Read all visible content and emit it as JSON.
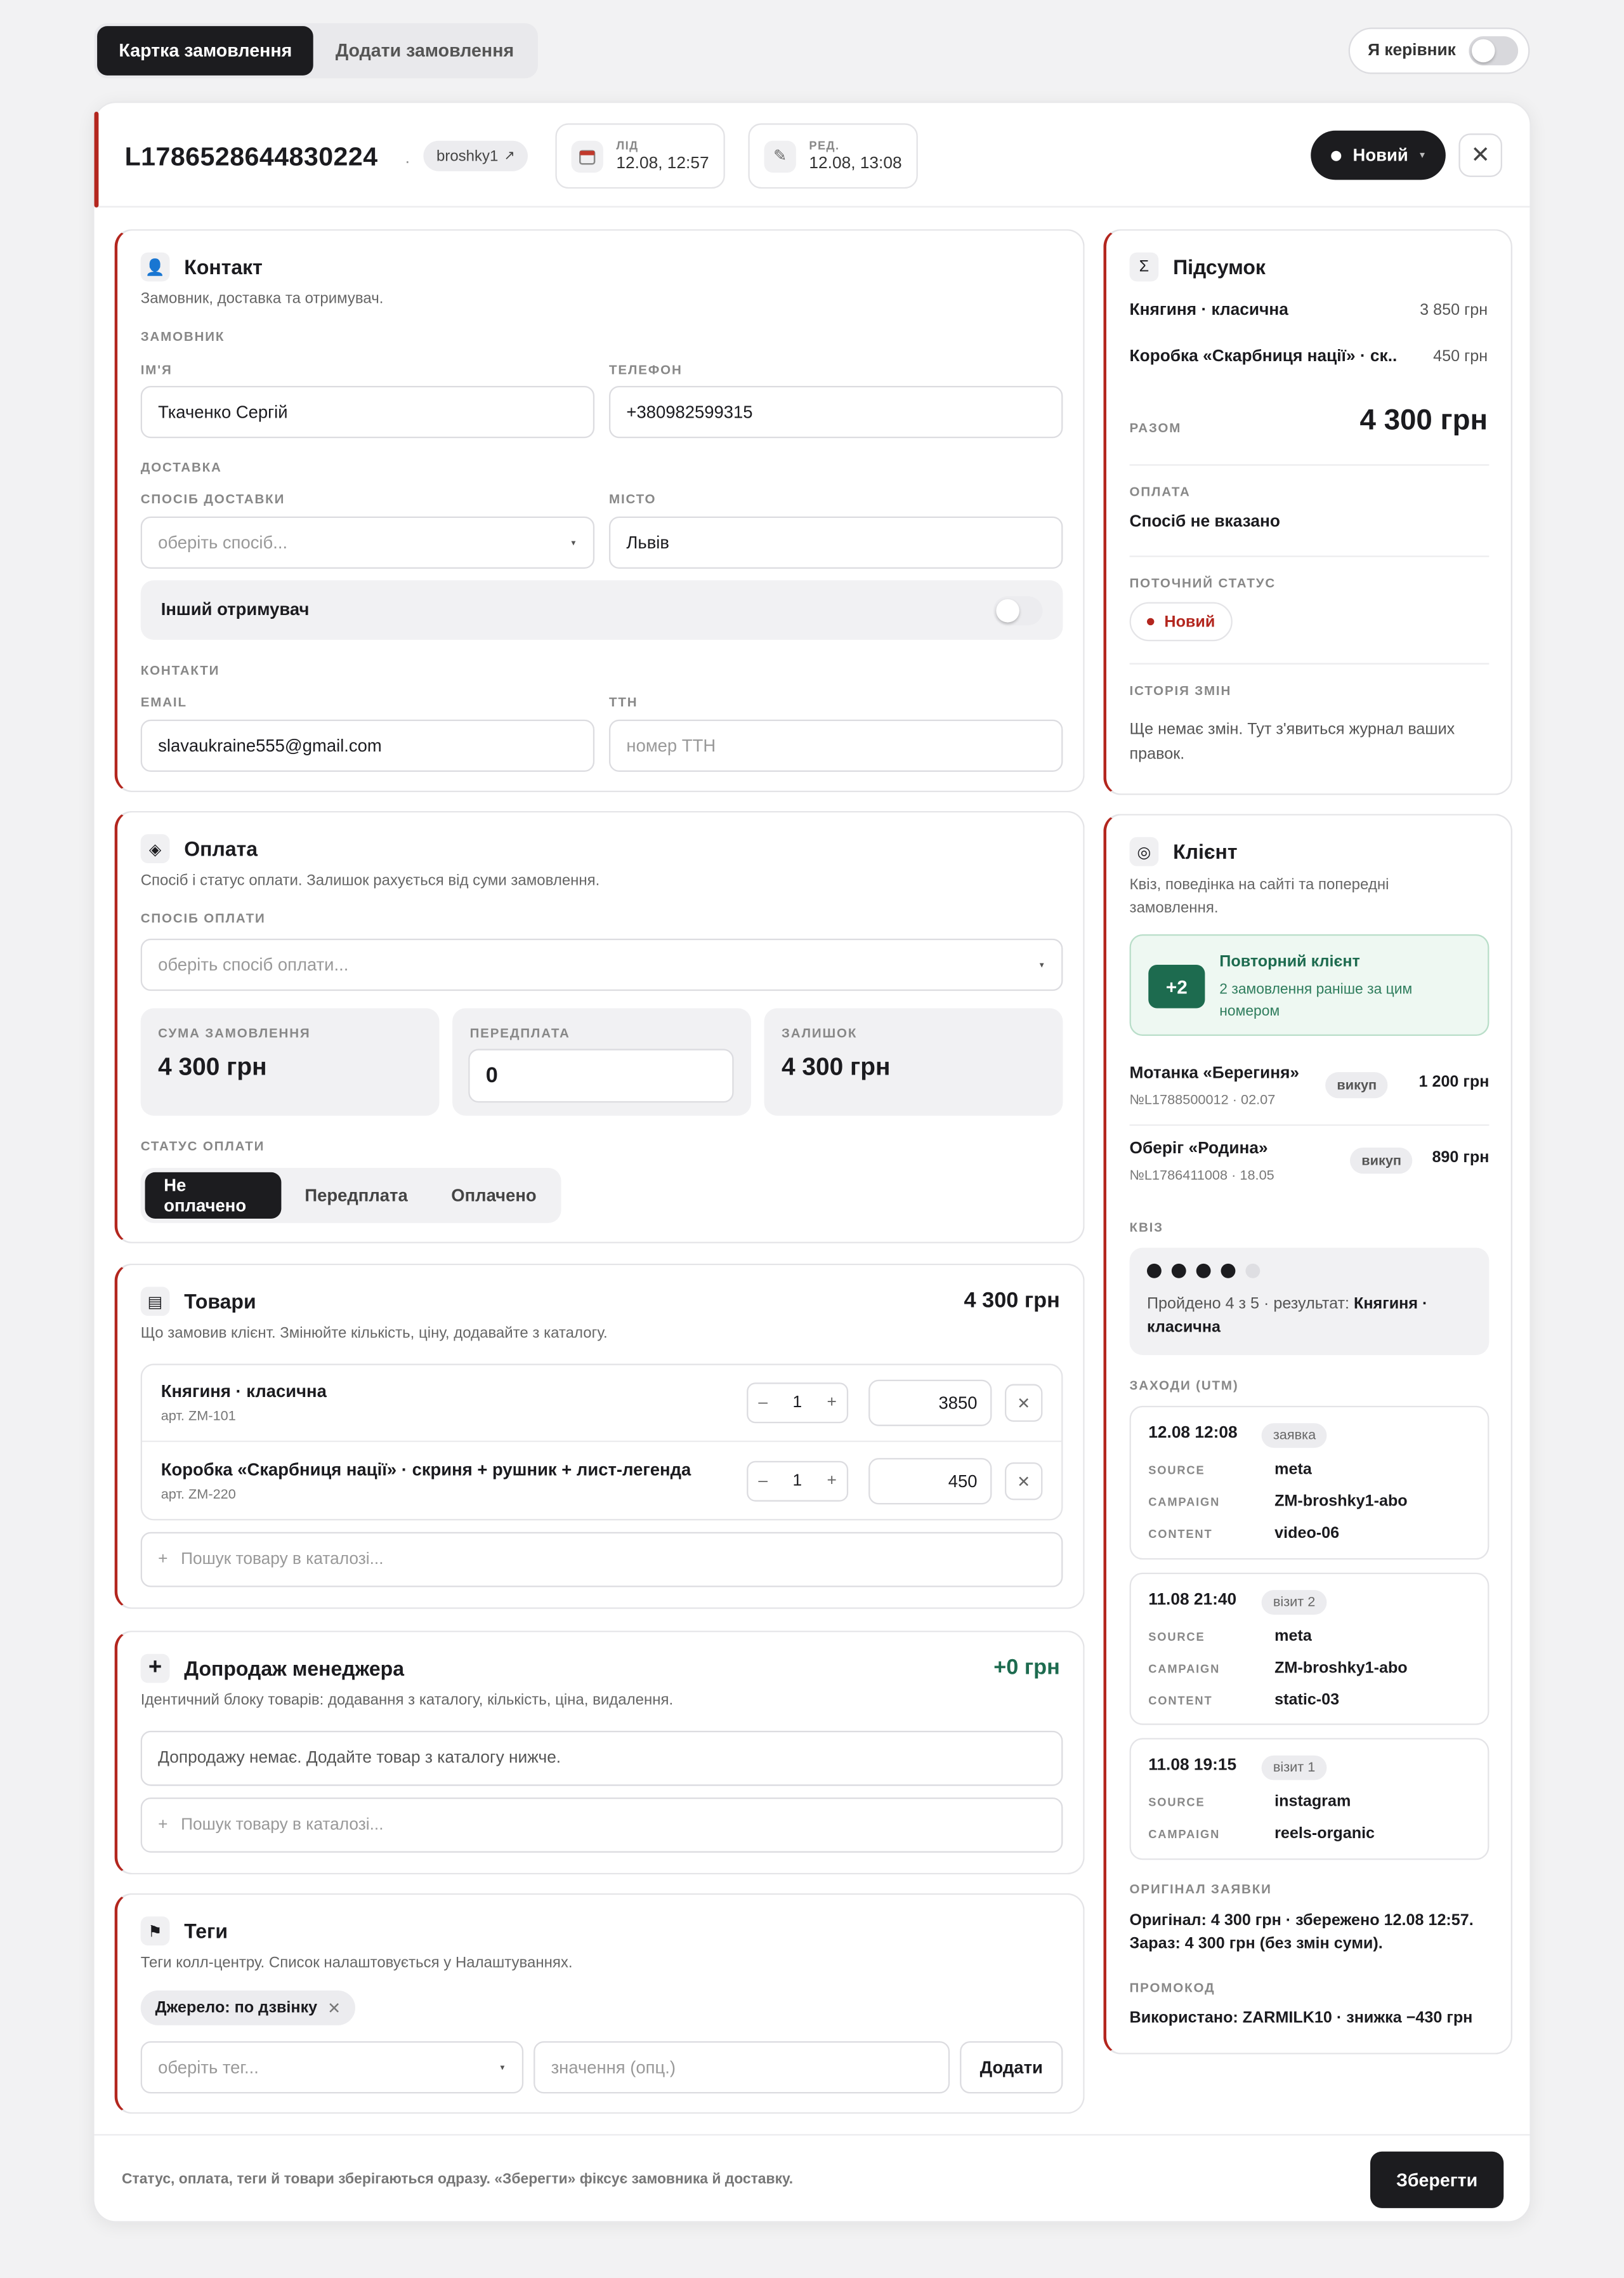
{
  "tabs": [
    "Картка замовлення",
    "Додати замовлення"
  ],
  "role": {
    "label": "Я керівник"
  },
  "order": {
    "id": "L1786528644830224",
    "source_chip": "broshky1",
    "lead_label": "ЛІД",
    "lead_value": "12.08, 12:57",
    "edit_label": "РЕД.",
    "edit_value": "12.08, 13:08",
    "status": "Новий"
  },
  "contact": {
    "title": "Контакт",
    "subtitle": "Замовник, доставка та отримувач.",
    "customer_group": "ЗАМОВНИК",
    "name_label": "ІМ'Я",
    "name_value": "Ткаченко Сергій",
    "phone_label": "ТЕЛЕФОН",
    "phone_value": "+380982599315",
    "delivery_group": "ДОСТАВКА",
    "method_label": "СПОСІБ ДОСТАВКИ",
    "method_placeholder": "оберіть спосіб...",
    "city_label": "МІСТО",
    "city_value": "Львів",
    "other_recipient": "Інший отримувач",
    "contacts_group": "КОНТАКТИ",
    "email_label": "EMAIL",
    "email_value": "slavaukraine555@gmail.com",
    "ttn_label": "ТТН",
    "ttn_placeholder": "номер ТТН"
  },
  "payment": {
    "title": "Оплата",
    "subtitle": "Спосіб і статус оплати. Залишок рахується від суми замовлення.",
    "method_label": "СПОСІБ ОПЛАТИ",
    "method_placeholder": "оберіть спосіб оплати...",
    "sum_label": "СУМА ЗАМОВЛЕННЯ",
    "sum_value": "4 300 грн",
    "prepay_label": "ПЕРЕДПЛАТА",
    "prepay_value": "0",
    "rest_label": "ЗАЛИШОК",
    "rest_value": "4 300 грн",
    "status_label": "СТАТУС ОПЛАТИ",
    "status_options": [
      "Не оплачено",
      "Передплата",
      "Оплачено"
    ]
  },
  "goods": {
    "title": "Товари",
    "total": "4 300 грн",
    "subtitle": "Що замовив клієнт. Змінюйте кількість, ціну, додавайте з каталогу.",
    "items": [
      {
        "name": "Княгиня · класична",
        "sku": "арт. ZM-101",
        "qty": "1",
        "price": "3850"
      },
      {
        "name": "Коробка «Скарбниця нації» · скриня + рушник + лист-легенда",
        "sku": "арт. ZM-220",
        "qty": "1",
        "price": "450"
      }
    ],
    "search_placeholder": "Пошук товару в каталозі..."
  },
  "upsell": {
    "title": "Допродаж менеджера",
    "total": "+0 грн",
    "subtitle": "Ідентичний блоку товарів: додавання з каталогу, кількість, ціна, видалення.",
    "empty": "Допродажу немає. Додайте товар з каталогу нижче.",
    "search_placeholder": "Пошук товару в каталозі..."
  },
  "tags": {
    "title": "Теги",
    "subtitle": "Теги колл-центру. Список налаштовується у Налаштуваннях.",
    "chip": "Джерело: по дзвінку",
    "select_placeholder": "оберіть тег...",
    "value_placeholder": "значення (опц.)",
    "add_label": "Додати"
  },
  "summary": {
    "title": "Підсумок",
    "lines": [
      {
        "name": "Княгиня · класична",
        "price": "3 850 грн"
      },
      {
        "name": "Коробка «Скарбниця нації» · ск...",
        "price": "450 грн"
      }
    ],
    "total_label": "РАЗОМ",
    "total_value": "4 300 грн",
    "payment_label": "ОПЛАТА",
    "payment_value": "Спосіб не вказано",
    "status_label": "ПОТОЧНИЙ СТАТУС",
    "status_value": "Новий",
    "history_label": "ІСТОРІЯ ЗМІН",
    "history_text": "Ще немає змін. Тут з'явиться журнал ваших правок."
  },
  "client": {
    "title": "Клієнт",
    "subtitle": "Квіз, поведінка на сайті та попередні замовлення.",
    "repeat_badge": "+2",
    "repeat_title": "Повторний клієнт",
    "repeat_text": "2 замовлення раніше за цим номером",
    "prev_orders": [
      {
        "name": "Мотанка «Берегиня»",
        "meta": "№L1788500012 · 02.07",
        "badge": "викуп",
        "price": "1 200 грн"
      },
      {
        "name": "Оберіг «Родина»",
        "meta": "№L1786411008 · 18.05",
        "badge": "викуп",
        "price": "890 грн"
      }
    ],
    "quiz_label": "КВІЗ",
    "quiz_progress": 0.8,
    "quiz_text": "Пройдено 4 з 5 · результат: ",
    "quiz_result": "Княгиня · класична",
    "utm_label": "ЗАХОДИ (UTM)",
    "utm": [
      {
        "time": "12.08 12:08",
        "tag": "заявка",
        "rows": [
          [
            "SOURCE",
            "meta"
          ],
          [
            "CAMPAIGN",
            "ZM-broshky1-abo"
          ],
          [
            "CONTENT",
            "video-06"
          ]
        ]
      },
      {
        "time": "11.08 21:40",
        "tag": "візит 2",
        "rows": [
          [
            "SOURCE",
            "meta"
          ],
          [
            "CAMPAIGN",
            "ZM-broshky1-abo"
          ],
          [
            "CONTENT",
            "static-03"
          ]
        ]
      },
      {
        "time": "11.08 19:15",
        "tag": "візит 1",
        "rows": [
          [
            "SOURCE",
            "instagram"
          ],
          [
            "CAMPAIGN",
            "reels-organic"
          ]
        ]
      }
    ],
    "original_label": "ОРИГІНАЛ ЗАЯВКИ",
    "original_text": "Оригінал: 4 300 грн · збережено 12.08 12:57. Зараз: 4 300 грн (без змін суми).",
    "promo_label": "ПРОМОКОД",
    "promo_text": "Використано: ZARMILK10 · знижка −430 грн"
  },
  "footer": {
    "note": "Статус, оплата, теги й товари зберігаються одразу. «Зберегти» фіксує замовника й доставку.",
    "save_label": "Зберегти"
  },
  "colors": {
    "accent": "#b3261e",
    "dark": "#1c1c1f",
    "green": "#1d6b4f"
  }
}
